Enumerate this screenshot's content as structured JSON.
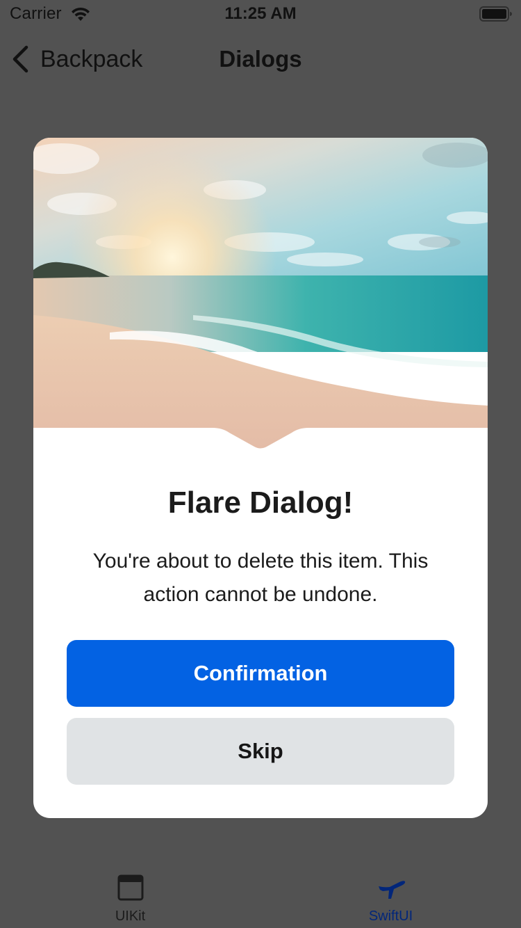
{
  "status_bar": {
    "carrier": "Carrier",
    "time": "11:25 AM",
    "icons": [
      "wifi-icon",
      "battery-icon"
    ]
  },
  "nav_bar": {
    "back_label": "Backpack",
    "title": "Dialogs",
    "back_icon": "chevron-left-icon"
  },
  "dialog": {
    "image": "beach-sunset-photo",
    "title": "Flare Dialog!",
    "message": "You're about to delete this item. This action cannot be undone.",
    "primary_button": "Confirmation",
    "secondary_button": "Skip"
  },
  "tab_bar": {
    "tabs": [
      {
        "label": "UIKit",
        "icon": "window-icon",
        "selected": false
      },
      {
        "label": "SwiftUI",
        "icon": "airplane-icon",
        "selected": true
      }
    ]
  },
  "colors": {
    "overlay": "#525252",
    "primary": "#0362e3",
    "secondary_button": "#e0e3e5",
    "selected_tab": "#02267a"
  }
}
